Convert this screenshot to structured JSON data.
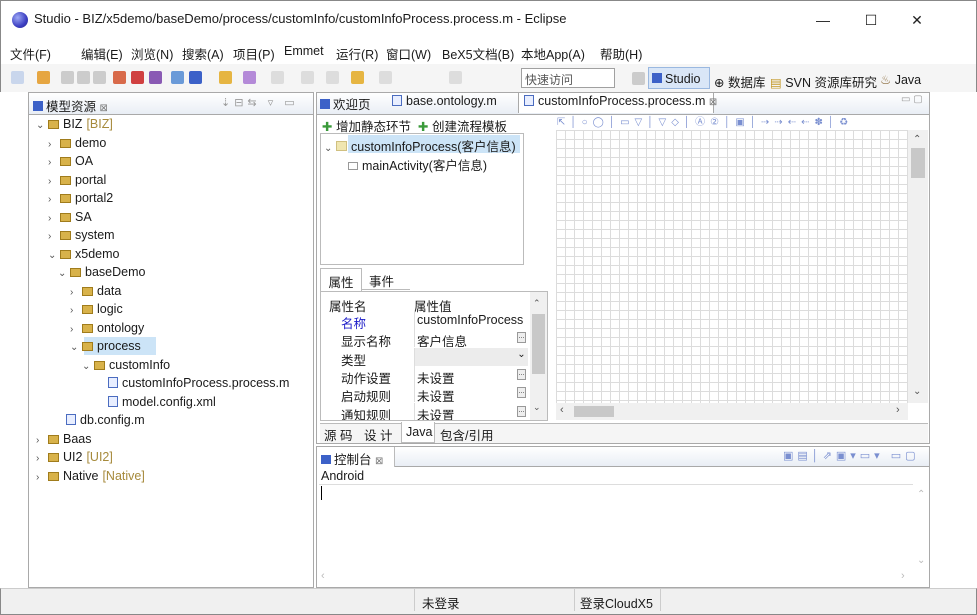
{
  "window": {
    "title": "Studio - BIZ/x5demo/baseDemo/process/customInfo/customInfoProcess.process.m - Eclipse",
    "minimize": "—",
    "maximize": "☐",
    "close": "✕"
  },
  "menubar": [
    "文件(F)",
    "编辑(E)",
    "浏览(N)",
    "搜索(A)",
    "项目(P)",
    "Emmet",
    "运行(R)",
    "窗口(W)",
    "BeX5文档(B)",
    "本地App(A)",
    "帮助(H)"
  ],
  "toolbar": {
    "quick_access": "快速访问",
    "perspectives": [
      "Studio",
      "数据库",
      "SVN 资源库研究",
      "Java"
    ]
  },
  "explorer": {
    "title": "模型资源",
    "close": "⊠",
    "items": [
      {
        "label": "BIZ",
        "tag": "[BIZ]",
        "arrow": "⌄"
      },
      {
        "label": "demo",
        "arrow": "›"
      },
      {
        "label": "OA",
        "arrow": "›"
      },
      {
        "label": "portal",
        "arrow": "›"
      },
      {
        "label": "portal2",
        "arrow": "›"
      },
      {
        "label": "SA",
        "arrow": "›"
      },
      {
        "label": "system",
        "arrow": "›"
      },
      {
        "label": "x5demo",
        "arrow": "⌄"
      },
      {
        "label": "baseDemo",
        "arrow": "⌄"
      },
      {
        "label": "data",
        "arrow": "›"
      },
      {
        "label": "logic",
        "arrow": "›"
      },
      {
        "label": "ontology",
        "arrow": "›"
      },
      {
        "label": "process",
        "arrow": "⌄"
      },
      {
        "label": "customInfo",
        "arrow": "⌄"
      },
      {
        "label": "customInfoProcess.process.m"
      },
      {
        "label": "model.config.xml"
      },
      {
        "label": "db.config.m"
      },
      {
        "label": "Baas",
        "arrow": "›"
      },
      {
        "label": "UI2",
        "tag": "[UI2]",
        "arrow": "›"
      },
      {
        "label": "Native",
        "tag": "[Native]",
        "arrow": "›"
      }
    ]
  },
  "editor": {
    "tabs": [
      "欢迎页",
      "base.ontology.m",
      "customInfoProcess.process.m"
    ],
    "tab_close": "⊠",
    "actions": [
      "增加静态环节",
      "创建流程模板"
    ],
    "outline": [
      {
        "label": "customInfoProcess(客户信息)",
        "arrow": "⌄"
      },
      {
        "label": "mainActivity(客户信息)"
      }
    ],
    "prop_tabs": [
      "属性",
      "事件"
    ],
    "prop_header": [
      "属性名",
      "属性值"
    ],
    "props": [
      {
        "name": "名称",
        "value": "customInfoProcess",
        "highlight": true
      },
      {
        "name": "显示名称",
        "value": "客户信息",
        "btn": "..."
      },
      {
        "name": "类型",
        "value": "",
        "btn": "⌄"
      },
      {
        "name": "动作设置",
        "value": "未设置",
        "btn": "..."
      },
      {
        "name": "启动规则",
        "value": "未设置",
        "btn": "..."
      },
      {
        "name": "通知规则",
        "value": "未设置",
        "btn": "..."
      }
    ],
    "bottom_tabs": [
      "源 码",
      "设 计",
      "Java",
      "包含/引用"
    ]
  },
  "console": {
    "title": "控制台",
    "close": "⊠",
    "header": "Android"
  },
  "status": {
    "login": "未登录",
    "cloud": "登录CloudX5"
  },
  "colors": {
    "accent": "#3c61c8",
    "selection": "#cce4f7",
    "link": "#1c1cc8",
    "tag": "#a68a3b"
  }
}
